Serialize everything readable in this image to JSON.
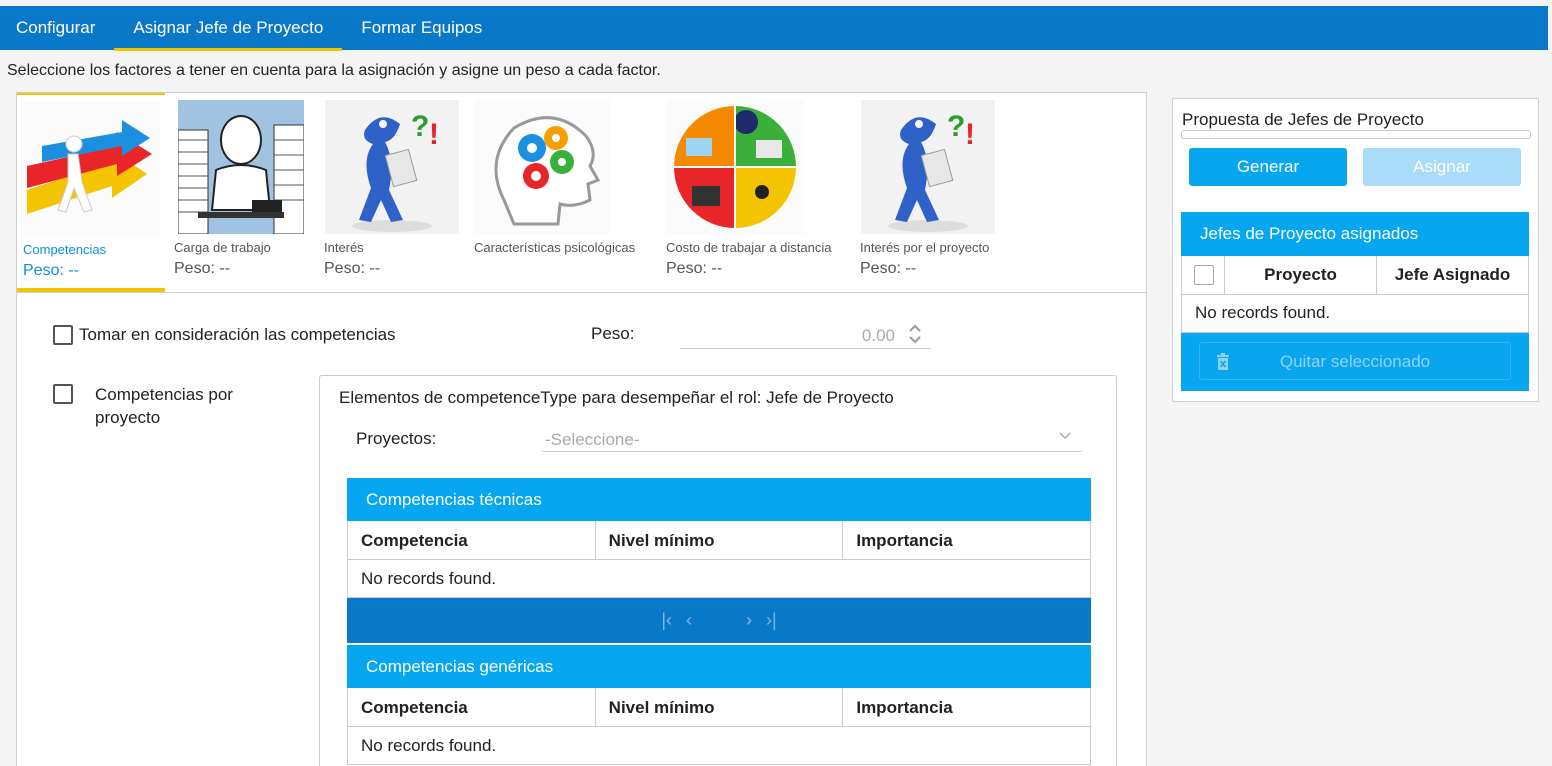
{
  "nav": {
    "tabs": [
      "Configurar",
      "Asignar Jefe de Proyecto",
      "Formar Equipos"
    ],
    "active": 1
  },
  "intro": "Seleccione los factores a tener en cuenta para la asignación y asigne un peso a cada factor.",
  "factors": [
    {
      "name": "Competencias",
      "peso": "Peso: --",
      "icon": "arrows-person-image"
    },
    {
      "name": "Carga de trabajo",
      "peso": "Peso: --",
      "icon": "overworked-person-image"
    },
    {
      "name": "Interés",
      "peso": "Peso: --",
      "icon": "question-mascot-image"
    },
    {
      "name": "Características psicológicas",
      "peso": "",
      "icon": "head-gears-image"
    },
    {
      "name": "Costo de trabajar a distancia",
      "peso": "Peso: --",
      "icon": "remote-work-circle-image"
    },
    {
      "name": "Interés por el proyecto",
      "peso": "Peso: --",
      "icon": "question-mascot-image"
    }
  ],
  "form": {
    "consider_label": "Tomar en consideración las competencias",
    "peso_label": "Peso:",
    "peso_value": "0.00",
    "por_proyecto_label": "Competencias por proyecto",
    "elements_title": "Elementos de competenceType para desempeñar el rol: Jefe de Proyecto",
    "proyectos_label": "Proyectos:",
    "proyectos_placeholder": "-Seleccione-"
  },
  "tecnicas": {
    "title": "Competencias técnicas",
    "columns": [
      "Competencia",
      "Nivel mínimo",
      "Importancia"
    ],
    "empty": "No records found."
  },
  "genericas": {
    "title": "Competencias genéricas",
    "columns": [
      "Competencia",
      "Nivel mínimo",
      "Importancia"
    ],
    "empty": "No records found."
  },
  "sidebar": {
    "title": "Propuesta de Jefes de Proyecto",
    "generar": "Generar",
    "asignar": "Asignar",
    "assigned_title": "Jefes de Proyecto asignados",
    "columns": [
      "Proyecto",
      "Jefe Asignado"
    ],
    "empty": "No records found.",
    "remove": "Quitar seleccionado"
  },
  "colors": {
    "nav": "#0a78c8",
    "accent": "#06a7f0",
    "highlight": "#f5c400"
  }
}
